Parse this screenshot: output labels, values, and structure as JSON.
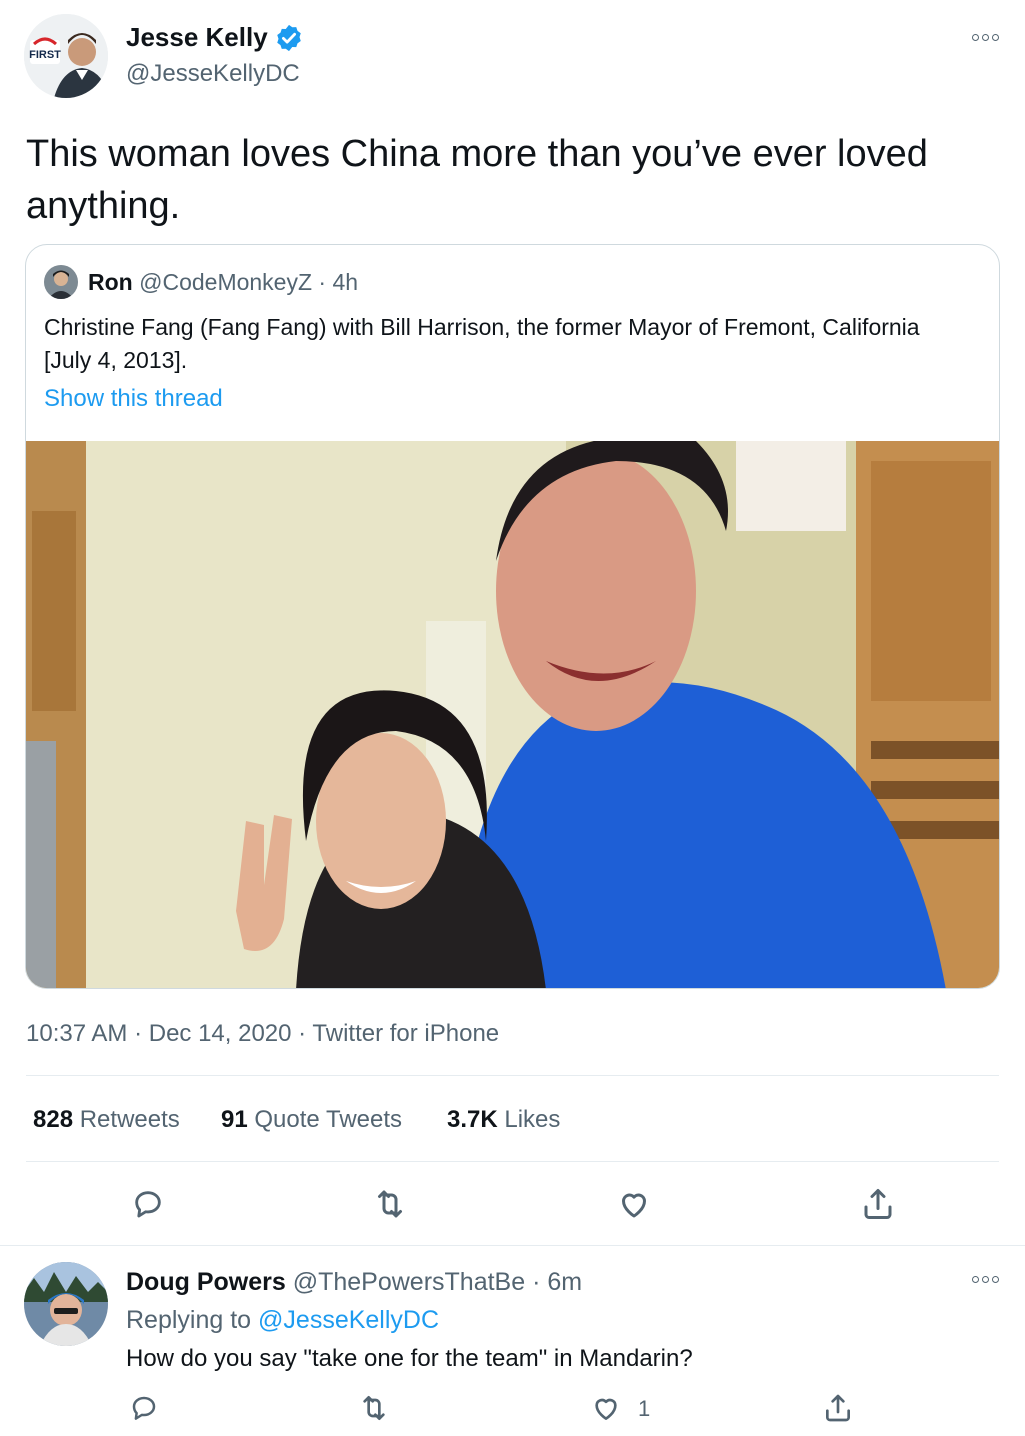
{
  "tweet": {
    "author_name": "Jesse Kelly",
    "author_handle": "@JesseKellyDC",
    "avatar_badge": "FIRST",
    "text": "This woman loves China more than you’ve ever loved anything.",
    "timestamp": "10:37 AM · Dec 14, 2020 · Twitter for iPhone",
    "stats": {
      "retweets_count": "828",
      "retweets_label": "Retweets",
      "quotes_count": "91",
      "quotes_label": "Quote Tweets",
      "likes_count": "3.7K",
      "likes_label": "Likes"
    }
  },
  "quoted": {
    "author_name": "Ron",
    "author_meta": "@CodeMonkeyZ · 4h",
    "text": "Christine Fang (Fang Fang) with Bill Harrison, the former Mayor of Fremont, California [July 4, 2013].",
    "show_thread": "Show this thread"
  },
  "reply": {
    "author_name": "Doug Powers",
    "author_meta": "@ThePowersThatBe · 6m",
    "replying_prefix": "Replying to",
    "replying_handle": "@JesseKellyDC",
    "text": "How do you say \"take one for the team\" in Mandarin?",
    "like_count": "1"
  },
  "colors": {
    "accent": "#1d9bf0",
    "muted": "#536471",
    "text": "#0f1419",
    "border": "#cfd9de"
  },
  "icons": [
    "more-icon",
    "verified-badge-icon",
    "reply-icon",
    "retweet-icon",
    "like-icon",
    "share-icon"
  ]
}
